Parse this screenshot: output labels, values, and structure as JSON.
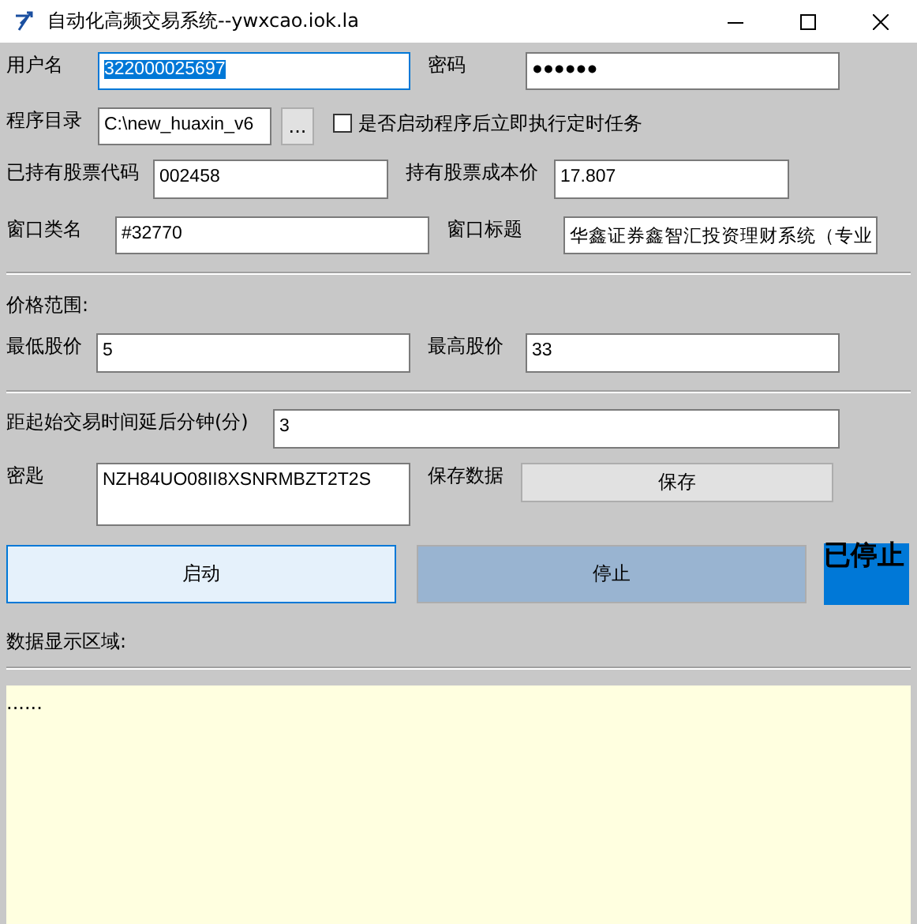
{
  "window": {
    "title": "自动化高频交易系统--ywxcao.iok.la"
  },
  "rows": [
    {
      "kind": "fields",
      "items": [
        {
          "kind": "label",
          "text": "用户名"
        },
        {
          "kind": "input",
          "value": "322000025697",
          "selected": true
        },
        {
          "kind": "label",
          "text": "密码"
        },
        {
          "kind": "input",
          "value": "●●●●●●",
          "selected": false
        }
      ]
    },
    {
      "kind": "fields",
      "items": [
        {
          "kind": "label",
          "text": "程序目录"
        },
        {
          "kind": "input",
          "value": "C:\\new_huaxin_v6",
          "selected": false
        },
        {
          "kind": "button",
          "text": "..."
        },
        {
          "kind": "checkbox",
          "text": "是否启动程序后立即执行定时任务",
          "checked": false
        }
      ]
    },
    {
      "kind": "fields",
      "items": [
        {
          "kind": "label",
          "text": "已持有股票代码"
        },
        {
          "kind": "input",
          "value": "002458",
          "selected": false
        },
        {
          "kind": "label",
          "text": "持有股票成本价"
        },
        {
          "kind": "input",
          "value": "17.807",
          "selected": false
        }
      ]
    },
    {
      "kind": "fields",
      "items": [
        {
          "kind": "label",
          "text": "窗口类名"
        },
        {
          "kind": "input",
          "value": "#32770",
          "selected": false
        },
        {
          "kind": "label",
          "text": "窗口标题"
        },
        {
          "kind": "input",
          "value": "华鑫证券鑫智汇投资理财系统（专业",
          "selected": false
        }
      ]
    },
    {
      "kind": "separator"
    },
    {
      "kind": "heading",
      "text": "价格范围:"
    },
    {
      "kind": "fields",
      "items": [
        {
          "kind": "label",
          "text": "最低股价"
        },
        {
          "kind": "input",
          "value": "5",
          "selected": false
        },
        {
          "kind": "label",
          "text": "最高股价"
        },
        {
          "kind": "input",
          "value": "33",
          "selected": false
        }
      ]
    },
    {
      "kind": "separator"
    },
    {
      "kind": "fields",
      "items": [
        {
          "kind": "label",
          "text": "距起始交易时间延后分钟(分)"
        },
        {
          "kind": "input",
          "value": "3",
          "selected": false
        }
      ]
    },
    {
      "kind": "fields",
      "items": [
        {
          "kind": "label",
          "text": "密匙"
        },
        {
          "kind": "input",
          "value": "NZH84UO08II8XSNRMBZT2T2S",
          "selected": false
        },
        {
          "kind": "label",
          "text": "保存数据"
        },
        {
          "kind": "button",
          "text": "保存"
        }
      ]
    }
  ],
  "actions": [
    {
      "label": "启动",
      "focused": true,
      "color": "#e5f1fb"
    },
    {
      "label": "停止",
      "focused": false,
      "color": "#99b4d1"
    }
  ],
  "status": {
    "text": "已停止",
    "color": "#0078d7"
  },
  "output": {
    "heading": "数据显示区域:",
    "text": "......"
  }
}
